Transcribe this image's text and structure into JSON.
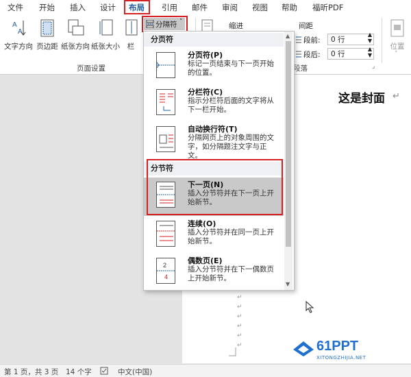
{
  "menubar": {
    "tabs": [
      "文件",
      "开始",
      "插入",
      "设计",
      "布局",
      "引用",
      "邮件",
      "审阅",
      "视图",
      "帮助",
      "福昕PDF"
    ],
    "active_index": 4
  },
  "ribbon": {
    "buttons": [
      "文字方向",
      "页边距",
      "纸张方向",
      "纸张大小",
      "栏"
    ],
    "breaks_button": "分隔符",
    "indent_label": "缩进",
    "spacing_label": "间距",
    "before_label": "段前:",
    "before_value": "0 行",
    "after_label": "段后:",
    "after_value": "0 行",
    "position_label": "位置",
    "group_page_setup": "页面设置",
    "group_para_suffix": "段落"
  },
  "dropdown": {
    "page_breaks_header": "分页符",
    "section_breaks_header": "分节符",
    "items": [
      {
        "title": "分页符(P)",
        "desc": "标记一页结束与下一页开始的位置。"
      },
      {
        "title": "分栏符(C)",
        "desc": "指示分栏符后面的文字将从下一栏开始。"
      },
      {
        "title": "自动换行符(T)",
        "desc": "分隔网页上的对象周围的文字，如分隔题注文字与正文。"
      },
      {
        "title": "下一页(N)",
        "desc": "插入分节符并在下一页上开始新节。"
      },
      {
        "title": "连续(O)",
        "desc": "插入分节符并在同一页上开始新节。"
      },
      {
        "title": "偶数页(E)",
        "desc": "插入分节符并在下一偶数页上开始新节。"
      }
    ],
    "selected_index": 3
  },
  "document": {
    "heading": "这是封面"
  },
  "statusbar": {
    "page": "第 1 页，共 3 页",
    "words": "14 个字",
    "language": "中文(中国)"
  },
  "watermark": {
    "logo_text": "61PPT",
    "url": "XITONGZHIJIA.NET"
  },
  "colors": {
    "accent": "#1e5c9e",
    "highlight_red": "#d42020"
  }
}
